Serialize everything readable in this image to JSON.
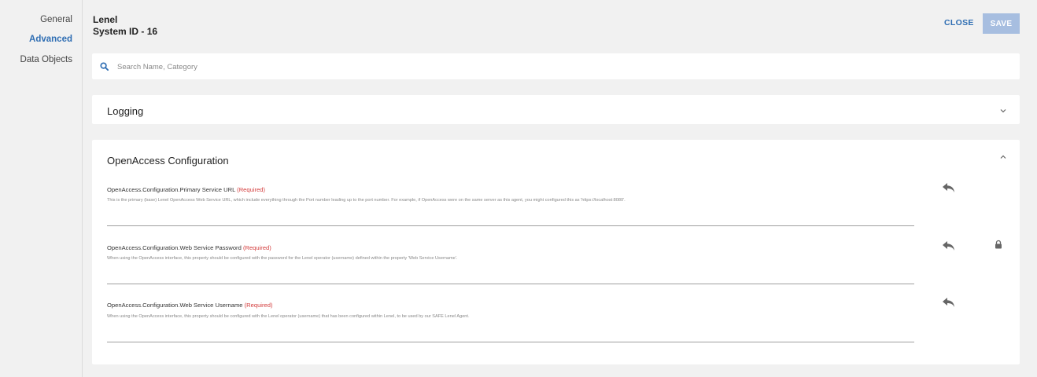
{
  "sidebar": {
    "items": [
      {
        "label": "General",
        "active": false
      },
      {
        "label": "Advanced",
        "active": true
      },
      {
        "label": "Data Objects",
        "active": false
      }
    ]
  },
  "header": {
    "title": "Lenel",
    "subtitle": "System ID - 16",
    "close_label": "CLOSE",
    "save_label": "SAVE"
  },
  "search": {
    "placeholder": "Search Name, Category",
    "value": ""
  },
  "sections": {
    "logging": {
      "title": "Logging",
      "expanded": false
    },
    "openaccess": {
      "title": "OpenAccess Configuration",
      "expanded": true,
      "properties": [
        {
          "name": "OpenAccess.Configuration.Primary Service URL",
          "required_label": "(Required)",
          "description": "This is the primary (base) Lenel OpenAccess Web Service URL, which include everything through the Port number leading up to the port number. For example, if OpenAccess were on the same server as this agent, you might configured this as 'https://localhost:8080'.",
          "value": "",
          "locked": false
        },
        {
          "name": "OpenAccess.Configuration.Web Service Password",
          "required_label": "(Required)",
          "description": "When using the OpenAccess interface, this property should be configured with the password for the Lenel operator (username) defined within the property 'Web Service Username'.",
          "value": "",
          "locked": true
        },
        {
          "name": "OpenAccess.Configuration.Web Service Username",
          "required_label": "(Required)",
          "description": "When using the OpenAccess interface, this property should be configured with the Lenel operator (username) that has been configured within Lenel, to be used by our SAFE Lenel Agent.",
          "value": "",
          "locked": false
        }
      ]
    }
  },
  "icons": {
    "search": "search-icon",
    "expand": "chevron-down-icon",
    "collapse": "chevron-up-icon",
    "revert": "undo-icon",
    "lock": "lock-icon"
  },
  "colors": {
    "accent": "#2f6eb3",
    "save_disabled": "#a7bee0",
    "required": "#d33b3b",
    "background": "#f1f1f1"
  }
}
